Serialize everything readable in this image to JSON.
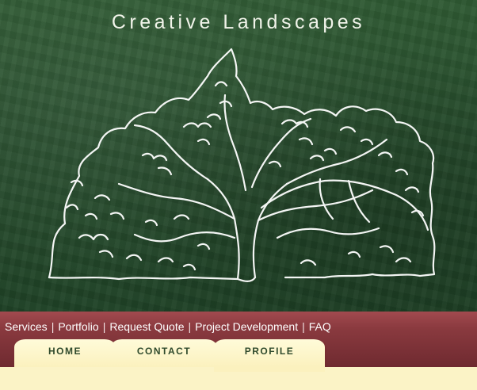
{
  "site": {
    "title": "Creative Landscapes"
  },
  "colors": {
    "hero_green": "#274d2d",
    "nav_maroon": "#8a3a3f",
    "tab_cream": "#fbf1be",
    "tab_text": "#2f4a2c"
  },
  "hero": {
    "illustration": "tree-line-drawing"
  },
  "nav_links": {
    "services": "Services",
    "portfolio": "Portfolio",
    "request_quote": "Request Quote",
    "project_development": "Project Development",
    "faq": "FAQ",
    "separator": "|"
  },
  "tabs": {
    "home": "HOME",
    "contact": "CONTACT",
    "profile": "PROFILE",
    "active": "PROFILE"
  }
}
